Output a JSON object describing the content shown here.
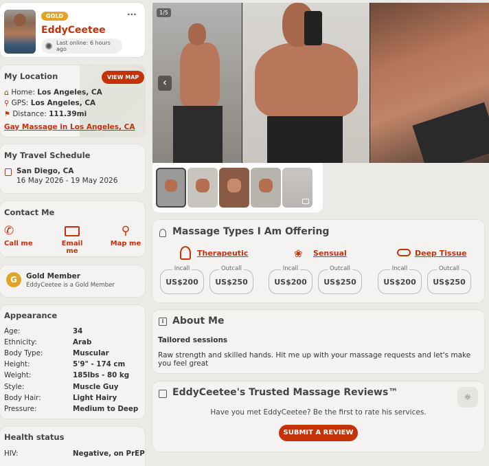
{
  "profile": {
    "badge": "GOLD",
    "name": "EddyCeetee",
    "last_online": "Last online: 6 hours ago",
    "more": "···"
  },
  "location": {
    "title": "My Location",
    "view_map": "VIEW MAP",
    "home_label": "Home:",
    "home_value": "Los Angeles, CA",
    "gps_label": "GPS:",
    "gps_value": "Los Angeles, CA",
    "distance_label": "Distance:",
    "distance_value": "111.39mi",
    "link": "Gay Massage in Los Angeles, CA"
  },
  "travel": {
    "title": "My Travel Schedule",
    "city": "San Diego, CA",
    "dates": "16 May 2026 - 19 May 2026"
  },
  "contact": {
    "title": "Contact Me",
    "call": "Call me",
    "email": "Email me",
    "map": "Map me"
  },
  "gold": {
    "title": "Gold Member",
    "subtitle": "EddyCeetee is a Gold Member"
  },
  "appearance": {
    "title": "Appearance",
    "rows": [
      {
        "label": "Age:",
        "value": "34"
      },
      {
        "label": "Ethnicity:",
        "value": "Arab"
      },
      {
        "label": "Body Type:",
        "value": "Muscular"
      },
      {
        "label": "Height:",
        "value": "5'9\" - 174 cm"
      },
      {
        "label": "Weight:",
        "value": "185lbs - 80 kg"
      },
      {
        "label": "Style:",
        "value": "Muscle Guy"
      },
      {
        "label": "Body Hair:",
        "value": "Light Hairy"
      },
      {
        "label": "Pressure:",
        "value": "Medium to Deep"
      }
    ]
  },
  "health": {
    "title": "Health status",
    "hiv_label": "HIV:",
    "hiv_value": "Negative, on PrEP"
  },
  "gallery": {
    "counter": "1/5",
    "prev": "‹"
  },
  "massage": {
    "title": "Massage Types I Am Offering",
    "types": [
      {
        "name": "Therapeutic",
        "incall_label": "Incall",
        "incall": "US$200",
        "outcall_label": "Outcall",
        "outcall": "US$250"
      },
      {
        "name": "Sensual",
        "incall_label": "Incall",
        "incall": "US$200",
        "outcall_label": "Outcall",
        "outcall": "US$250"
      },
      {
        "name": "Deep Tissue",
        "incall_label": "Incall",
        "incall": "US$200",
        "outcall_label": "Outcall",
        "outcall": "US$250"
      }
    ]
  },
  "about": {
    "title": "About Me",
    "heading": "Tailored sessions",
    "text": "Raw strength and skilled hands. Hit me up with your massage requests and let's make you feel great"
  },
  "reviews": {
    "title": "EddyCeetee's Trusted Massage Reviews™",
    "prompt": "Have you met EddyCeetee? Be the first to rate his services.",
    "button": "SUBMIT A REVIEW"
  },
  "colors": {
    "accent": "#c4320a",
    "gold": "#e0a426",
    "background": "#eceae7",
    "card": "#f4f3f1"
  }
}
